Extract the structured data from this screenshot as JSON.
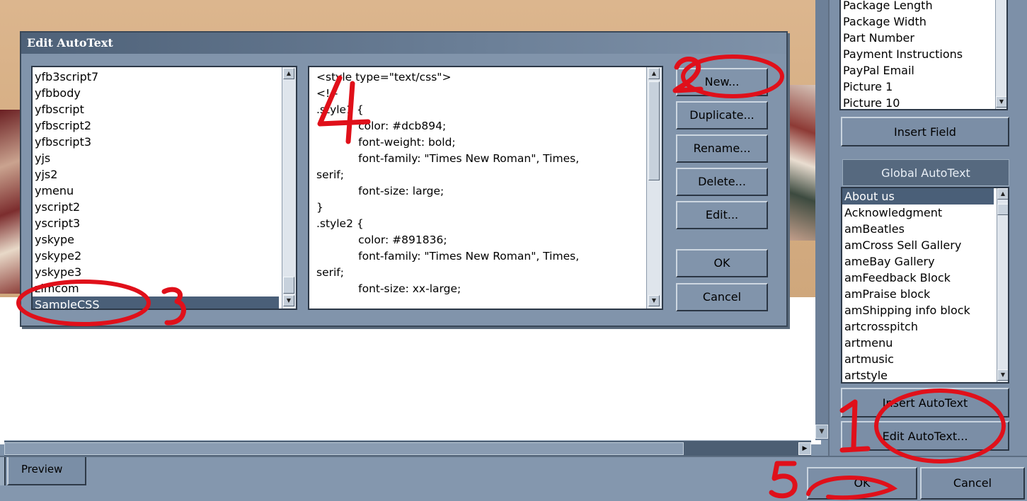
{
  "dialog": {
    "title": "Edit AutoText",
    "snippets": [
      "yfb3script7",
      "yfbbody",
      "yfbscript",
      "yfbscript2",
      "yfbscript3",
      "yjs",
      "yjs2",
      "ymenu",
      "yscript2",
      "yscript3",
      "yskype",
      "yskype2",
      "yskype3",
      "zimcom",
      "SampleCSS"
    ],
    "selected_snippet": "SampleCSS",
    "code_lines": [
      "<style type=\"text/css\">",
      "<!--",
      ".style1 {",
      "            color: #dcb894;",
      "            font-weight: bold;",
      "            font-family: \"Times New Roman\", Times,",
      "serif;",
      "            font-size: large;",
      "}",
      ".style2 {",
      "            color: #891836;",
      "            font-family: \"Times New Roman\", Times,",
      "serif;",
      "            font-size: xx-large;"
    ],
    "buttons": {
      "new": "New...",
      "duplicate": "Duplicate...",
      "rename": "Rename...",
      "delete": "Delete...",
      "edit": "Edit...",
      "ok": "OK",
      "cancel": "Cancel"
    }
  },
  "right_panel": {
    "fields": [
      "Package Length",
      "Package Width",
      "Part Number",
      "Payment Instructions",
      "PayPal Email",
      "Picture 1",
      "Picture 10"
    ],
    "insert_field_label": "Insert Field",
    "global_autotext_header": "Global AutoText",
    "autotext_items": [
      "About us",
      "Acknowledgment",
      "amBeatles",
      "amCross Sell Gallery",
      "ameBay Gallery",
      "amFeedback Block",
      "amPraise block",
      "amShipping info block",
      "artcrosspitch",
      "artmenu",
      "artmusic",
      "artstyle"
    ],
    "selected_autotext": "About us",
    "insert_autotext_label": "Insert AutoText",
    "edit_autotext_label": "Edit AutoText..."
  },
  "bottom": {
    "preview_tab": "Preview",
    "ok_label": "OK",
    "cancel_label": "Cancel"
  },
  "annotations": {
    "step1": "1",
    "step2": "2",
    "step3": "3",
    "step4": "4",
    "step5": "5",
    "color": "#e0101a"
  }
}
